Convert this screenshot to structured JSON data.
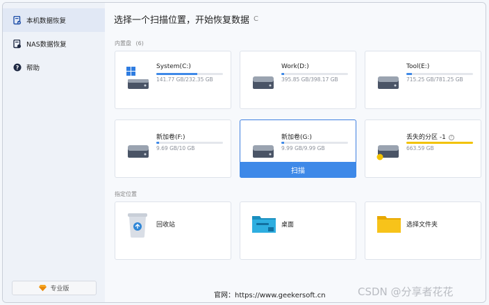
{
  "sidebar": {
    "items": [
      {
        "label": "本机数据恢复",
        "icon": "document-recovery-icon",
        "active": true
      },
      {
        "label": "NAS数据恢复",
        "icon": "nas-icon",
        "active": false
      },
      {
        "label": "帮助",
        "icon": "help-icon",
        "active": false
      }
    ],
    "pro_label": "专业版"
  },
  "header": {
    "title": "选择一个扫描位置，开始恢复数据",
    "refresh_icon": "refresh-icon"
  },
  "drives_section": {
    "label": "内置盘",
    "count": "(6)",
    "drives": [
      {
        "name": "System(C:)",
        "size": "141.77 GB/232.35 GB",
        "used_fraction": 0.61,
        "bar_color": "#3e89e8",
        "icon": "windows-drive-icon"
      },
      {
        "name": "Work(D:)",
        "size": "395.85 GB/398.17 GB",
        "used_fraction": 0.01,
        "bar_color": "#3e89e8",
        "icon": "drive-icon"
      },
      {
        "name": "Tool(E:)",
        "size": "715.25 GB/781.25 GB",
        "used_fraction": 0.08,
        "bar_color": "#3e89e8",
        "icon": "drive-icon"
      },
      {
        "name": "新加卷(F:)",
        "size": "9.69 GB/10 GB",
        "used_fraction": 0.03,
        "bar_color": "#3e89e8",
        "icon": "drive-icon"
      },
      {
        "name": "新加卷(G:)",
        "size": "9.99 GB/9.99 GB",
        "used_fraction": 0.01,
        "bar_color": "#3e89e8",
        "icon": "drive-icon",
        "selected": true
      },
      {
        "name": "丢失的分区 -1",
        "size": "663.59 GB",
        "used_fraction": 1.0,
        "bar_color": "#f2c200",
        "icon": "lost-partition-icon"
      }
    ],
    "scan_label": "扫描"
  },
  "locations_section": {
    "label": "指定位置",
    "items": [
      {
        "label": "回收站",
        "icon": "recycle-bin-icon"
      },
      {
        "label": "桌面",
        "icon": "desktop-icon"
      },
      {
        "label": "选择文件夹",
        "icon": "folder-icon"
      }
    ]
  },
  "footer": {
    "url_text": "官网：https://www.geekersoft.cn"
  },
  "watermark": "CSDN @分享者花花",
  "colors": {
    "accent": "#3e89e8",
    "lost_bar": "#f2c200"
  }
}
